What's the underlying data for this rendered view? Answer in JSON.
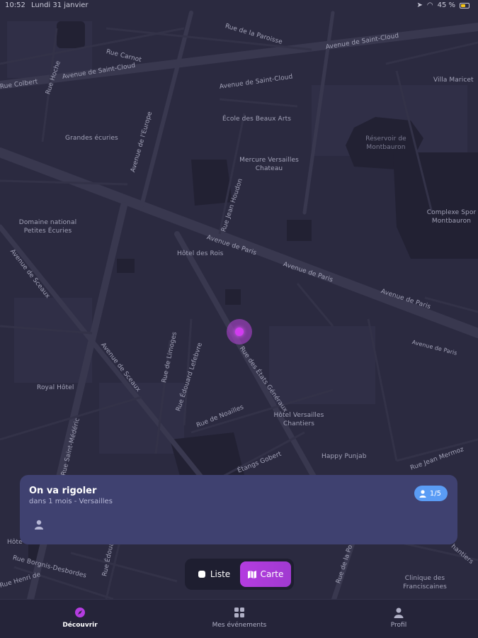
{
  "status_bar": {
    "time": "10:52",
    "date": "Lundi 31 janvier",
    "battery": "45 %"
  },
  "map": {
    "labels": {
      "rue_de_la_paroisse": "Rue de la Paroisse",
      "avenue_de_saint_cloud_top": "Avenue de Saint-Cloud",
      "rue_carnot": "Rue Carnot",
      "rue_hoche": "Rue Hoche",
      "rue_colbert": "Rue Colbert",
      "avenue_de_saint_cloud_left": "Avenue de Saint-Cloud",
      "avenue_de_saint_cloud_mid": "Avenue de Saint-Cloud",
      "villa_maricet": "Villa Maricet",
      "ecole_beaux_arts": "École des Beaux Arts",
      "grandes_ecuries": "Grandes écuries",
      "avenue_de_l_europe": "Avenue de l'Europe",
      "reservoir": "Réservoir de Montbauron",
      "mercure": "Mercure Versailles Chateau",
      "complexe_sport": "Complexe Spor Montbauron",
      "rue_jean_houdon": "Rue Jean Houdon",
      "domaine_national": "Domaine national Petites Écuries",
      "avenue_de_paris_1": "Avenue de Paris",
      "avenue_de_paris_2": "Avenue de Paris",
      "avenue_de_paris_3": "Avenue de Paris",
      "avenue_de_paris_4": "Avenue de Paris",
      "hotel_des_rois": "Hôtel des Rois",
      "avenue_de_sceaux_1": "Avenue de Sceaux",
      "avenue_de_sceaux_2": "Avenue de Sceaux",
      "rue_des_etats_generaux": "Rue des États Généraux",
      "rue_de_limoges": "Rue de Limoges",
      "rue_edouard_lefebvre": "Rue Édouard Lefebvre",
      "royal_hotel": "Royal Hôtel",
      "rue_de_noailles": "Rue de Noailles",
      "hotel_versailles_chantiers": "Hôtel Versailles Chantiers",
      "rue_saint_medéric": "Rue Saint-Médéric",
      "etangs_gobert": "Étangs Gobert",
      "happy_punjab": "Happy Punjab",
      "rue_jean_mermoz": "Rue Jean Mermoz",
      "rue_edouard_bottom": "Rue Édouard",
      "rue_borgnis": "Rue Borgnis-Desbordes",
      "rue_henri": "Rue Henri de",
      "hotel_left": "Hôte",
      "rue_de_la_po": "Rue de la Po",
      "clinique": "Clinique des Franciscaines",
      "chantiers_right": "hantiers"
    }
  },
  "event_card": {
    "title": "On va rigoler",
    "subtitle": "dans 1 mois - Versailles",
    "participants_badge": "1/5"
  },
  "view_toggle": {
    "list_label": "Liste",
    "map_label": "Carte",
    "selected": "Carte"
  },
  "bottom_nav": {
    "items": [
      {
        "label": "Découvrir",
        "active": true
      },
      {
        "label": "Mes événements",
        "active": false
      },
      {
        "label": "Profil",
        "active": false
      }
    ]
  },
  "colors": {
    "map_background": "#2b2a40",
    "accent": "#b43ce0",
    "badge": "#5a9cf5",
    "card": "#3f4170"
  }
}
